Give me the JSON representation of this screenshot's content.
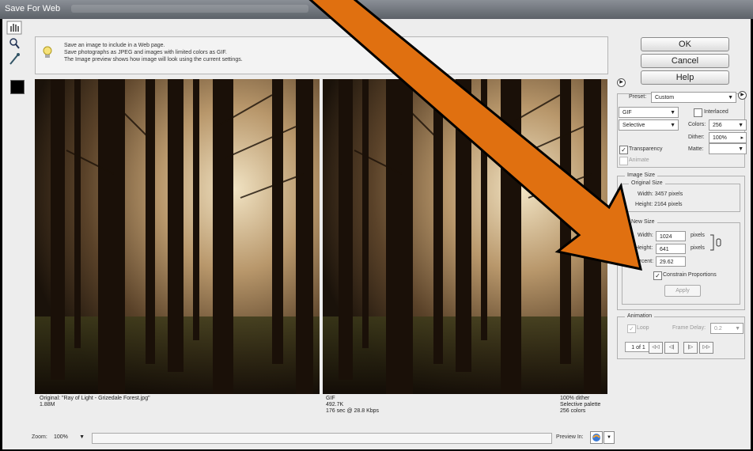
{
  "window": {
    "title": "Save For Web"
  },
  "info": {
    "line1": "Save an image to include in a Web page.",
    "line2": "Save photographs as JPEG and images with limited colors as GIF.",
    "line3": "The Image preview shows how image will look using the current settings."
  },
  "buttons": {
    "ok": "OK",
    "cancel": "Cancel",
    "help": "Help"
  },
  "settings": {
    "preset_label": "Preset:",
    "preset_value": "Custom",
    "format_value": "GIF",
    "interlaced_label": "Interlaced",
    "reduction_value": "Selective",
    "colors_label": "Colors:",
    "colors_value": "256",
    "dither_label": "Dither:",
    "dither_value": "100%",
    "transparency_label": "Transparency",
    "matte_label": "Matte:",
    "animate_label": "Animate"
  },
  "image_size": {
    "section_label": "Image Size",
    "original_label": "Original Size",
    "width_text": "Width:  3457 pixels",
    "height_text": "Height:  2164 pixels",
    "new_size_label": "New Size",
    "width_label": "Width:",
    "width_value": "1024",
    "height_label": "Height:",
    "height_value": "641",
    "pixels_unit": "pixels",
    "percent_label": "Percent:",
    "percent_value": "29.62",
    "constrain_label": "Constrain Proportions",
    "apply_label": "Apply"
  },
  "animation": {
    "section_label": "Animation",
    "loop_label": "Loop",
    "frame_delay_label": "Frame Delay:",
    "frame_delay_value": "0.2",
    "frame_counter": "1 of 1"
  },
  "original_info": {
    "line1": "Original: \"Ray of Light - Grizedale Forest.jpg\"",
    "line2": "1.88M"
  },
  "optimized_info": {
    "line1": "GIF",
    "line2": "492.7K",
    "line3": "176 sec @ 28.8 Kbps",
    "r1": "100% dither",
    "r2": "Selective palette",
    "r3": "256 colors"
  },
  "bottom": {
    "zoom_label": "Zoom:",
    "zoom_value": "100%",
    "preview_label": "Preview In:"
  },
  "colors": {
    "arrow": "#e07010",
    "arrow_outline": "#000000"
  }
}
